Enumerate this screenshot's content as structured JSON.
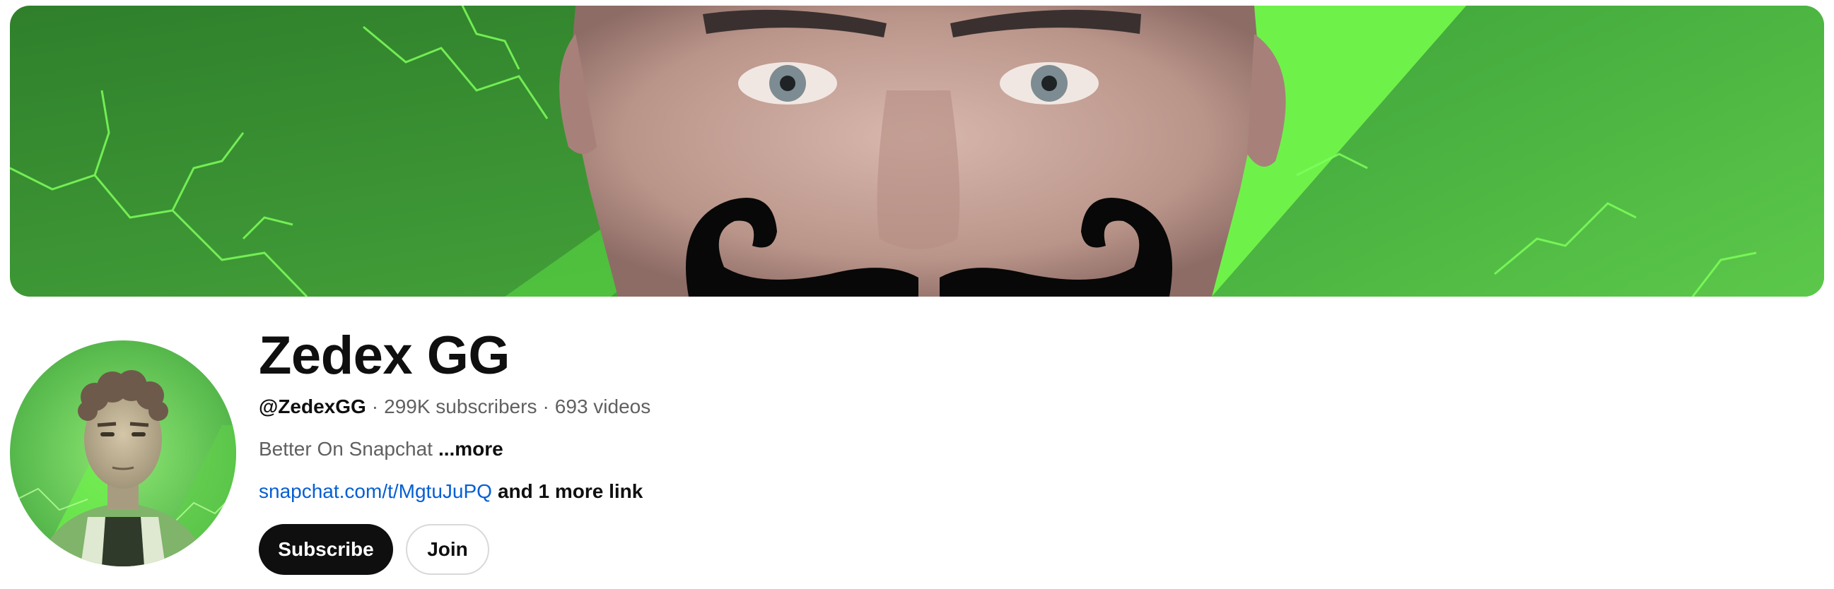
{
  "banner": {
    "description": "",
    "colors": {
      "dark": "#2f8f2a",
      "mid": "#4fc93f",
      "bright": "#6ef24a"
    }
  },
  "avatar": {},
  "channel": {
    "name": "Zedex GG",
    "handle": "@ZedexGG",
    "separator": "·",
    "subscribers": "299K subscribers",
    "videos": "693 videos",
    "description": "Better On Snapchat",
    "more_label": "...more",
    "link_text": "snapchat.com/t/MgtuJuPQ",
    "more_links": "and 1 more link"
  },
  "actions": {
    "subscribe_label": "Subscribe",
    "join_label": "Join"
  },
  "colors": {
    "text_primary": "#0f0f0f",
    "text_secondary": "#606060",
    "link": "#065fd4",
    "subscribe_bg": "#0f0f0f"
  }
}
